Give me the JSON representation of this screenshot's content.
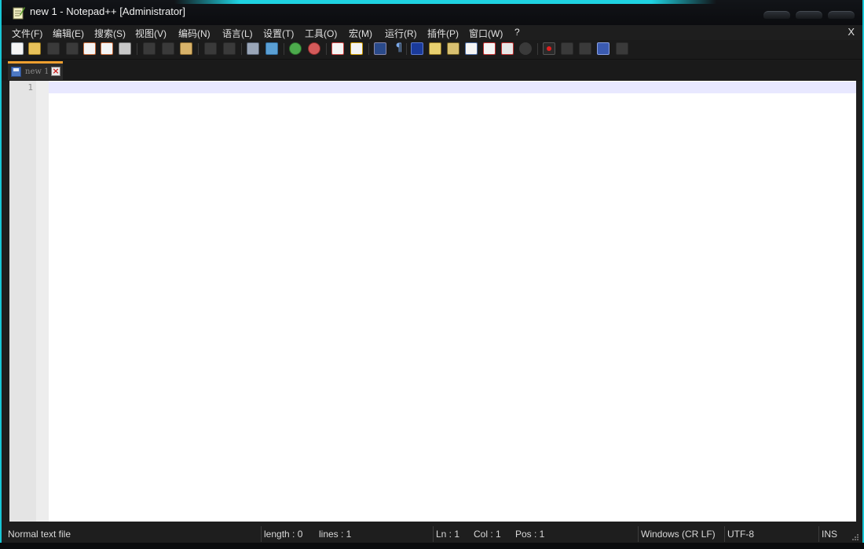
{
  "window": {
    "title": "new 1 - Notepad++ [Administrator]"
  },
  "menu": {
    "items": [
      "文件(F)",
      "编辑(E)",
      "搜索(S)",
      "视图(V)",
      "编码(N)",
      "语言(L)",
      "设置(T)",
      "工具(O)",
      "宏(M)",
      "运行(R)",
      "插件(P)",
      "窗口(W)",
      "?"
    ],
    "close_label": "X"
  },
  "toolbar": {
    "icons": [
      "new-file-icon",
      "open-file-icon",
      "save-icon",
      "save-all-icon",
      "close-icon",
      "close-all-icon",
      "print-icon",
      "cut-icon",
      "copy-icon",
      "paste-icon",
      "undo-icon",
      "redo-icon",
      "find-icon",
      "replace-icon",
      "zoom-in-icon",
      "zoom-out-icon",
      "sync-vertical-icon",
      "sync-horizontal-icon",
      "word-wrap-icon",
      "show-all-chars-icon",
      "indent-guide-icon",
      "user-language-icon",
      "doc-map-icon",
      "function-list-icon",
      "folder-workspace-icon",
      "document-monitor-icon",
      "record-macro-icon",
      "stop-record-icon",
      "play-macro-icon",
      "run-macro-multiple-icon",
      "save-macro-icon"
    ]
  },
  "tabs": [
    {
      "label": "new 1",
      "active": true
    }
  ],
  "editor": {
    "line_numbers": [
      "1"
    ],
    "content": ""
  },
  "status": {
    "file_type": "Normal text file",
    "length": "length : 0",
    "lines": "lines : 1",
    "ln": "Ln : 1",
    "col": "Col : 1",
    "pos": "Pos : 1",
    "eol": "Windows (CR LF)",
    "encoding": "UTF-8",
    "mode": "INS"
  },
  "colors": {
    "accent": "#1fd3e2",
    "tab_active": "#f0a030",
    "current_line": "#e8e8ff"
  }
}
